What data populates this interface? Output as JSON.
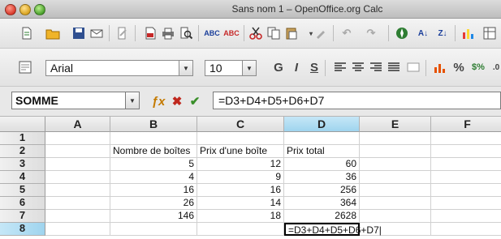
{
  "window": {
    "title": "Sans nom 1 – OpenOffice.org Calc"
  },
  "toolbar": {
    "font_name": "Arial",
    "font_size": "10"
  },
  "formula_bar": {
    "name_box": "SOMME",
    "formula": "=D3+D4+D5+D6+D7",
    "function_wizard_icon": "function-wizard-icon",
    "cancel_icon": "cancel-icon",
    "accept_icon": "accept-icon"
  },
  "columns": [
    "A",
    "B",
    "C",
    "D",
    "E",
    "F"
  ],
  "rows": [
    "1",
    "2",
    "3",
    "4",
    "5",
    "6",
    "7",
    "8"
  ],
  "cells": {
    "B2": "Nombre de boîtes",
    "C2": "Prix d'une boîte",
    "D2": "Prix total",
    "B3": "5",
    "C3": "12",
    "D3": "60",
    "B4": "4",
    "C4": "9",
    "D4": "36",
    "B5": "16",
    "C5": "16",
    "D5": "256",
    "B6": "26",
    "C6": "14",
    "D6": "364",
    "B7": "146",
    "C7": "18",
    "D7": "2628",
    "D8": "=D3+D4+D5+D6+D7"
  },
  "selection": {
    "column": "D",
    "row": "8"
  },
  "colors": {
    "selection_header": "#a8d8f0",
    "accept": "#3a8f2a",
    "cancel": "#c0281e"
  }
}
